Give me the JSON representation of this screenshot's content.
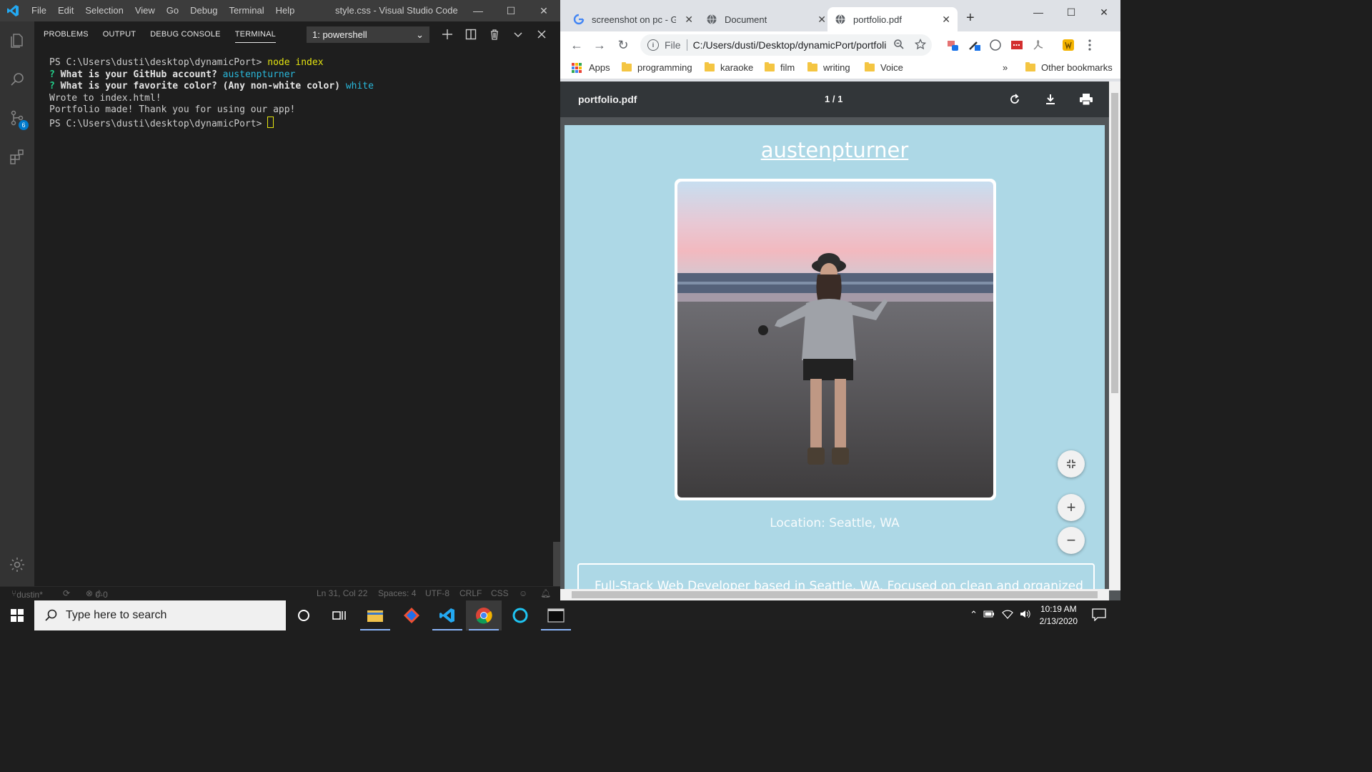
{
  "vscode": {
    "window_title": "style.css - Visual Studio Code",
    "menu": [
      "File",
      "Edit",
      "Selection",
      "View",
      "Go",
      "Debug",
      "Terminal",
      "Help"
    ],
    "activity_badge": "6",
    "panel_tabs": [
      "PROBLEMS",
      "OUTPUT",
      "DEBUG CONSOLE",
      "TERMINAL"
    ],
    "active_panel_tab": "TERMINAL",
    "terminal_select": "1: powershell",
    "terminal": {
      "line1_prompt": "PS C:\\Users\\dusti\\desktop\\dynamicPort> ",
      "line1_cmd": "node index",
      "line2_q": "?",
      "line2_text": " What is your GitHub account? ",
      "line2_answer": "austenpturner",
      "line3_q": "?",
      "line3_text": " What is your favorite color? (Any non-white color) ",
      "line3_answer": "white",
      "line4": "Wrote to index.html!",
      "line5": "Portfolio made! Thank you for using our app!",
      "line6_prompt": "PS C:\\Users\\dusti\\desktop\\dynamicPort> "
    },
    "status": {
      "branch": "dustin*",
      "problems": "0",
      "warnings": "0",
      "position": "Ln 31, Col 22",
      "spaces": "Spaces: 4",
      "encoding": "UTF-8",
      "eol": "CRLF",
      "language": "CSS"
    }
  },
  "chrome": {
    "tabs": [
      {
        "title": "screenshot on pc - Go",
        "icon": "google-icon"
      },
      {
        "title": "Document",
        "icon": "globe-icon"
      },
      {
        "title": "portfolio.pdf",
        "icon": "globe-icon",
        "active": true
      }
    ],
    "omnibox_scheme": "File",
    "omnibox_url": "C:/Users/dusti/Desktop/dynamicPort/portfolio.pdf",
    "bookmarks": [
      "Apps",
      "programming",
      "karaoke",
      "film",
      "writing",
      "Voice"
    ],
    "other_bookmarks": "Other bookmarks",
    "overflow": "»"
  },
  "pdf": {
    "file_name": "portfolio.pdf",
    "page_indicator": "1 / 1",
    "heading": "austenpturner",
    "location": "Location: Seattle, WA",
    "bio": "Full-Stack Web Developer based in Seattle, WA. Focused on clean and organized",
    "page_color": "#add8e6"
  },
  "taskbar": {
    "search_placeholder": "Type here to search",
    "time": "10:19 AM",
    "date": "2/13/2020"
  }
}
